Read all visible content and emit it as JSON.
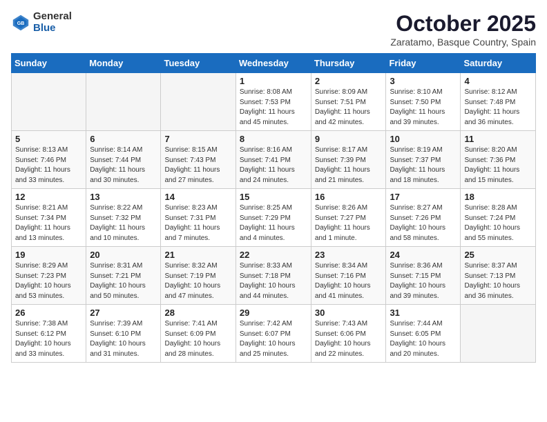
{
  "header": {
    "logo_general": "General",
    "logo_blue": "Blue",
    "title": "October 2025",
    "location": "Zaratamo, Basque Country, Spain"
  },
  "days_of_week": [
    "Sunday",
    "Monday",
    "Tuesday",
    "Wednesday",
    "Thursday",
    "Friday",
    "Saturday"
  ],
  "weeks": [
    [
      {
        "day": "",
        "info": ""
      },
      {
        "day": "",
        "info": ""
      },
      {
        "day": "",
        "info": ""
      },
      {
        "day": "1",
        "info": "Sunrise: 8:08 AM\nSunset: 7:53 PM\nDaylight: 11 hours and 45 minutes."
      },
      {
        "day": "2",
        "info": "Sunrise: 8:09 AM\nSunset: 7:51 PM\nDaylight: 11 hours and 42 minutes."
      },
      {
        "day": "3",
        "info": "Sunrise: 8:10 AM\nSunset: 7:50 PM\nDaylight: 11 hours and 39 minutes."
      },
      {
        "day": "4",
        "info": "Sunrise: 8:12 AM\nSunset: 7:48 PM\nDaylight: 11 hours and 36 minutes."
      }
    ],
    [
      {
        "day": "5",
        "info": "Sunrise: 8:13 AM\nSunset: 7:46 PM\nDaylight: 11 hours and 33 minutes."
      },
      {
        "day": "6",
        "info": "Sunrise: 8:14 AM\nSunset: 7:44 PM\nDaylight: 11 hours and 30 minutes."
      },
      {
        "day": "7",
        "info": "Sunrise: 8:15 AM\nSunset: 7:43 PM\nDaylight: 11 hours and 27 minutes."
      },
      {
        "day": "8",
        "info": "Sunrise: 8:16 AM\nSunset: 7:41 PM\nDaylight: 11 hours and 24 minutes."
      },
      {
        "day": "9",
        "info": "Sunrise: 8:17 AM\nSunset: 7:39 PM\nDaylight: 11 hours and 21 minutes."
      },
      {
        "day": "10",
        "info": "Sunrise: 8:19 AM\nSunset: 7:37 PM\nDaylight: 11 hours and 18 minutes."
      },
      {
        "day": "11",
        "info": "Sunrise: 8:20 AM\nSunset: 7:36 PM\nDaylight: 11 hours and 15 minutes."
      }
    ],
    [
      {
        "day": "12",
        "info": "Sunrise: 8:21 AM\nSunset: 7:34 PM\nDaylight: 11 hours and 13 minutes."
      },
      {
        "day": "13",
        "info": "Sunrise: 8:22 AM\nSunset: 7:32 PM\nDaylight: 11 hours and 10 minutes."
      },
      {
        "day": "14",
        "info": "Sunrise: 8:23 AM\nSunset: 7:31 PM\nDaylight: 11 hours and 7 minutes."
      },
      {
        "day": "15",
        "info": "Sunrise: 8:25 AM\nSunset: 7:29 PM\nDaylight: 11 hours and 4 minutes."
      },
      {
        "day": "16",
        "info": "Sunrise: 8:26 AM\nSunset: 7:27 PM\nDaylight: 11 hours and 1 minute."
      },
      {
        "day": "17",
        "info": "Sunrise: 8:27 AM\nSunset: 7:26 PM\nDaylight: 10 hours and 58 minutes."
      },
      {
        "day": "18",
        "info": "Sunrise: 8:28 AM\nSunset: 7:24 PM\nDaylight: 10 hours and 55 minutes."
      }
    ],
    [
      {
        "day": "19",
        "info": "Sunrise: 8:29 AM\nSunset: 7:23 PM\nDaylight: 10 hours and 53 minutes."
      },
      {
        "day": "20",
        "info": "Sunrise: 8:31 AM\nSunset: 7:21 PM\nDaylight: 10 hours and 50 minutes."
      },
      {
        "day": "21",
        "info": "Sunrise: 8:32 AM\nSunset: 7:19 PM\nDaylight: 10 hours and 47 minutes."
      },
      {
        "day": "22",
        "info": "Sunrise: 8:33 AM\nSunset: 7:18 PM\nDaylight: 10 hours and 44 minutes."
      },
      {
        "day": "23",
        "info": "Sunrise: 8:34 AM\nSunset: 7:16 PM\nDaylight: 10 hours and 41 minutes."
      },
      {
        "day": "24",
        "info": "Sunrise: 8:36 AM\nSunset: 7:15 PM\nDaylight: 10 hours and 39 minutes."
      },
      {
        "day": "25",
        "info": "Sunrise: 8:37 AM\nSunset: 7:13 PM\nDaylight: 10 hours and 36 minutes."
      }
    ],
    [
      {
        "day": "26",
        "info": "Sunrise: 7:38 AM\nSunset: 6:12 PM\nDaylight: 10 hours and 33 minutes."
      },
      {
        "day": "27",
        "info": "Sunrise: 7:39 AM\nSunset: 6:10 PM\nDaylight: 10 hours and 31 minutes."
      },
      {
        "day": "28",
        "info": "Sunrise: 7:41 AM\nSunset: 6:09 PM\nDaylight: 10 hours and 28 minutes."
      },
      {
        "day": "29",
        "info": "Sunrise: 7:42 AM\nSunset: 6:07 PM\nDaylight: 10 hours and 25 minutes."
      },
      {
        "day": "30",
        "info": "Sunrise: 7:43 AM\nSunset: 6:06 PM\nDaylight: 10 hours and 22 minutes."
      },
      {
        "day": "31",
        "info": "Sunrise: 7:44 AM\nSunset: 6:05 PM\nDaylight: 10 hours and 20 minutes."
      },
      {
        "day": "",
        "info": ""
      }
    ]
  ]
}
